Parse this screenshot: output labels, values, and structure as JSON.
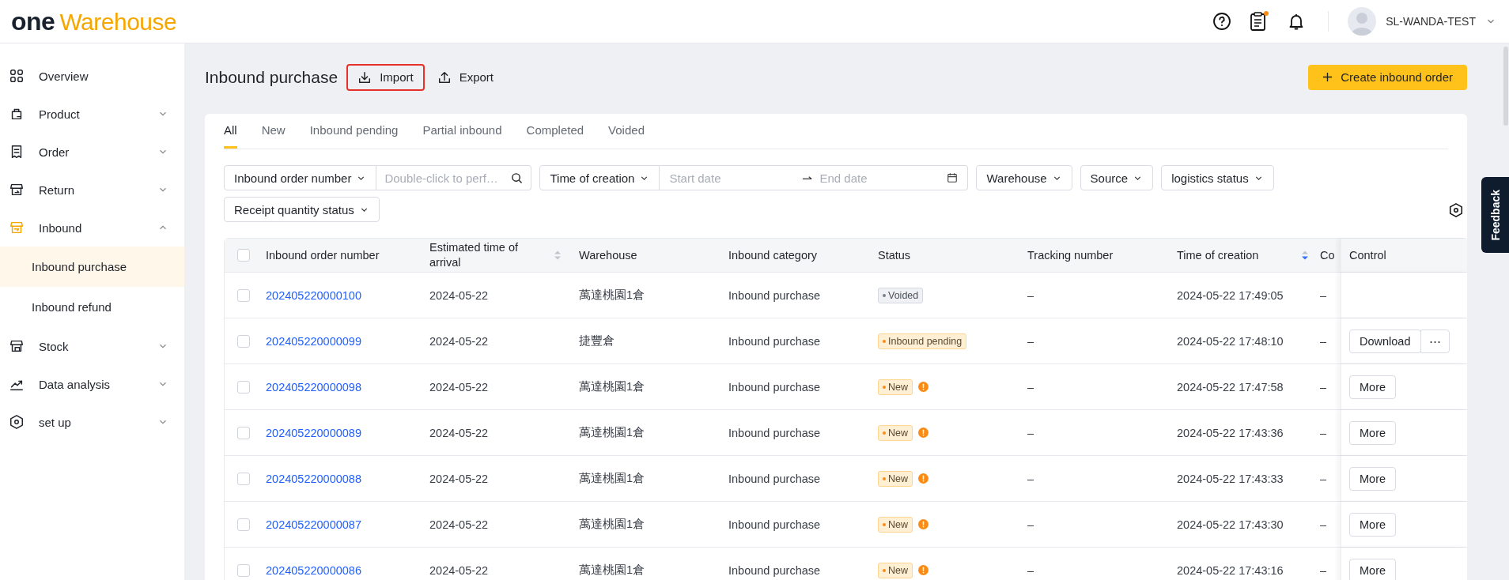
{
  "header": {
    "logo": {
      "brand": "one",
      "product": "Warehouse"
    },
    "has_unread": true,
    "user_name": "SL-WANDA-TEST"
  },
  "sidebar": {
    "items": [
      {
        "label": "Overview"
      },
      {
        "label": "Product",
        "expanded": false
      },
      {
        "label": "Order",
        "expanded": false
      },
      {
        "label": "Return",
        "expanded": false
      },
      {
        "label": "Inbound",
        "expanded": true,
        "children": [
          {
            "label": "Inbound purchase",
            "selected": true
          },
          {
            "label": "Inbound refund",
            "selected": false
          }
        ]
      },
      {
        "label": "Stock",
        "expanded": false
      },
      {
        "label": "Data analysis",
        "expanded": false
      },
      {
        "label": "set up",
        "expanded": false
      }
    ]
  },
  "page": {
    "title": "Inbound purchase",
    "toolbar": [
      {
        "label": "Import",
        "kind": "import",
        "highlighted": true
      },
      {
        "label": "Export",
        "kind": "export",
        "highlighted": false
      }
    ],
    "create_button": "Create inbound order"
  },
  "tabs": [
    {
      "label": "All",
      "selected": true
    },
    {
      "label": "New",
      "selected": false
    },
    {
      "label": "Inbound pending",
      "selected": false
    },
    {
      "label": "Partial inbound",
      "selected": false
    },
    {
      "label": "Completed",
      "selected": false
    },
    {
      "label": "Voided",
      "selected": false
    }
  ],
  "filters": [
    {
      "kind": "select-search",
      "label": "Inbound order number",
      "placeholder": "Double-click to perf…"
    },
    {
      "kind": "select-daterange",
      "label": "Time of creation",
      "start_placeholder": "Start date",
      "end_placeholder": "End date"
    },
    {
      "kind": "select",
      "label": "Warehouse"
    },
    {
      "kind": "select",
      "label": "Source"
    },
    {
      "kind": "select",
      "label": "logistics status"
    },
    {
      "kind": "select",
      "label": "Receipt quantity status"
    }
  ],
  "table": {
    "select_all": {
      "checked": false
    },
    "columns": [
      {
        "label": "Inbound order number"
      },
      {
        "label": "Estimated time of arrival",
        "sort_descending": false
      },
      {
        "label": "Warehouse"
      },
      {
        "label": "Inbound category"
      },
      {
        "label": "Status"
      },
      {
        "label": "Tracking number"
      },
      {
        "label": "Time of creation",
        "sort_descending": true
      },
      {
        "label": "Co"
      },
      {
        "label": "Control"
      }
    ],
    "rows": [
      {
        "checked": false,
        "order_number": "202405220000100",
        "eta": "2024-05-22",
        "warehouse": "萬達桃園1倉",
        "category": "Inbound purchase",
        "status": {
          "label": "Voided",
          "kind": "voided"
        },
        "warning": false,
        "tracking": "–",
        "created": "2024-05-22 17:49:05",
        "column_8": "–"
      },
      {
        "checked": false,
        "order_number": "202405220000099",
        "eta": "2024-05-22",
        "warehouse": "捷豐倉",
        "category": "Inbound purchase",
        "status": {
          "label": "Inbound pending",
          "kind": "pending"
        },
        "warning": false,
        "tracking": "–",
        "created": "2024-05-22 17:48:10",
        "column_8": "–",
        "actions": [
          {
            "label": "Download",
            "kind": "button"
          },
          {
            "label": "⋯",
            "kind": "more"
          }
        ]
      },
      {
        "checked": false,
        "order_number": "202405220000098",
        "eta": "2024-05-22",
        "warehouse": "萬達桃園1倉",
        "category": "Inbound purchase",
        "status": {
          "label": "New",
          "kind": "new"
        },
        "warning": true,
        "tracking": "–",
        "created": "2024-05-22 17:47:58",
        "column_8": "–",
        "actions": [
          {
            "label": "More",
            "kind": "button"
          }
        ]
      },
      {
        "checked": false,
        "order_number": "202405220000089",
        "eta": "2024-05-22",
        "warehouse": "萬達桃園1倉",
        "category": "Inbound purchase",
        "status": {
          "label": "New",
          "kind": "new"
        },
        "warning": true,
        "tracking": "–",
        "created": "2024-05-22 17:43:36",
        "column_8": "–",
        "actions": [
          {
            "label": "More",
            "kind": "button"
          }
        ]
      },
      {
        "checked": false,
        "order_number": "202405220000088",
        "eta": "2024-05-22",
        "warehouse": "萬達桃園1倉",
        "category": "Inbound purchase",
        "status": {
          "label": "New",
          "kind": "new"
        },
        "warning": true,
        "tracking": "–",
        "created": "2024-05-22 17:43:33",
        "column_8": "–",
        "actions": [
          {
            "label": "More",
            "kind": "button"
          }
        ]
      },
      {
        "checked": false,
        "order_number": "202405220000087",
        "eta": "2024-05-22",
        "warehouse": "萬達桃園1倉",
        "category": "Inbound purchase",
        "status": {
          "label": "New",
          "kind": "new"
        },
        "warning": true,
        "tracking": "–",
        "created": "2024-05-22 17:43:30",
        "column_8": "–",
        "actions": [
          {
            "label": "More",
            "kind": "button"
          }
        ]
      },
      {
        "checked": false,
        "order_number": "202405220000086",
        "eta": "2024-05-22",
        "warehouse": "萬達桃園1倉",
        "category": "Inbound purchase",
        "status": {
          "label": "New",
          "kind": "new"
        },
        "warning": true,
        "tracking": "–",
        "created": "2024-05-22 17:43:16",
        "column_8": "–",
        "actions": [
          {
            "label": "More",
            "kind": "button"
          }
        ]
      }
    ]
  },
  "feedback_tab": "Feedback"
}
